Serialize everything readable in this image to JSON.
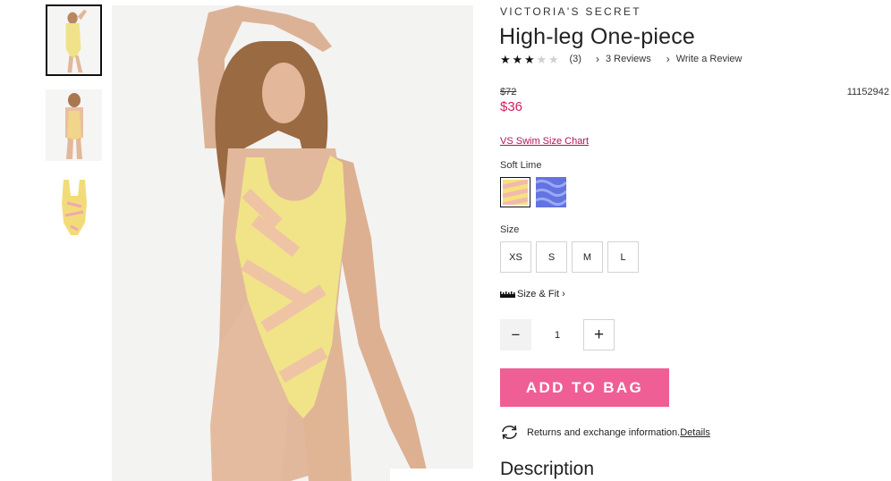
{
  "brand": "VICTORIA'S SECRET",
  "product": {
    "title": "High-leg One-piece",
    "rating_stars": 3,
    "rating_max": 5,
    "review_count": "(3)",
    "reviews_link": "3 Reviews",
    "write_review_link": "Write a Review",
    "original_price": "$72",
    "sale_price": "$36",
    "sku": "11152942"
  },
  "size_chart_link": "VS Swim Size Chart",
  "color": {
    "selected_label": "Soft Lime",
    "swatches": [
      {
        "name": "soft-lime-swatch",
        "colors": [
          "#f6e27a",
          "#f2b9b0"
        ]
      },
      {
        "name": "blue-swatch",
        "colors": [
          "#5f6fe0",
          "#8ea0f0"
        ]
      }
    ]
  },
  "size": {
    "label": "Size",
    "options": [
      "XS",
      "S",
      "M",
      "L"
    ]
  },
  "size_fit_link": "Size & Fit",
  "quantity": {
    "minus": "−",
    "value": "1",
    "plus": "+"
  },
  "add_to_bag": "ADD TO BAG",
  "returns": {
    "text": "Returns and exchange information.",
    "link": "Details"
  },
  "description_heading": "Description",
  "colors": {
    "sale_price": "#d01f5f",
    "size_chart_link": "#b3135a",
    "add_to_bag_bg": "#ef5e94"
  },
  "icons": {
    "chevron": "chevron-right-icon",
    "ruler": "ruler-icon",
    "returns": "refresh-icon"
  }
}
